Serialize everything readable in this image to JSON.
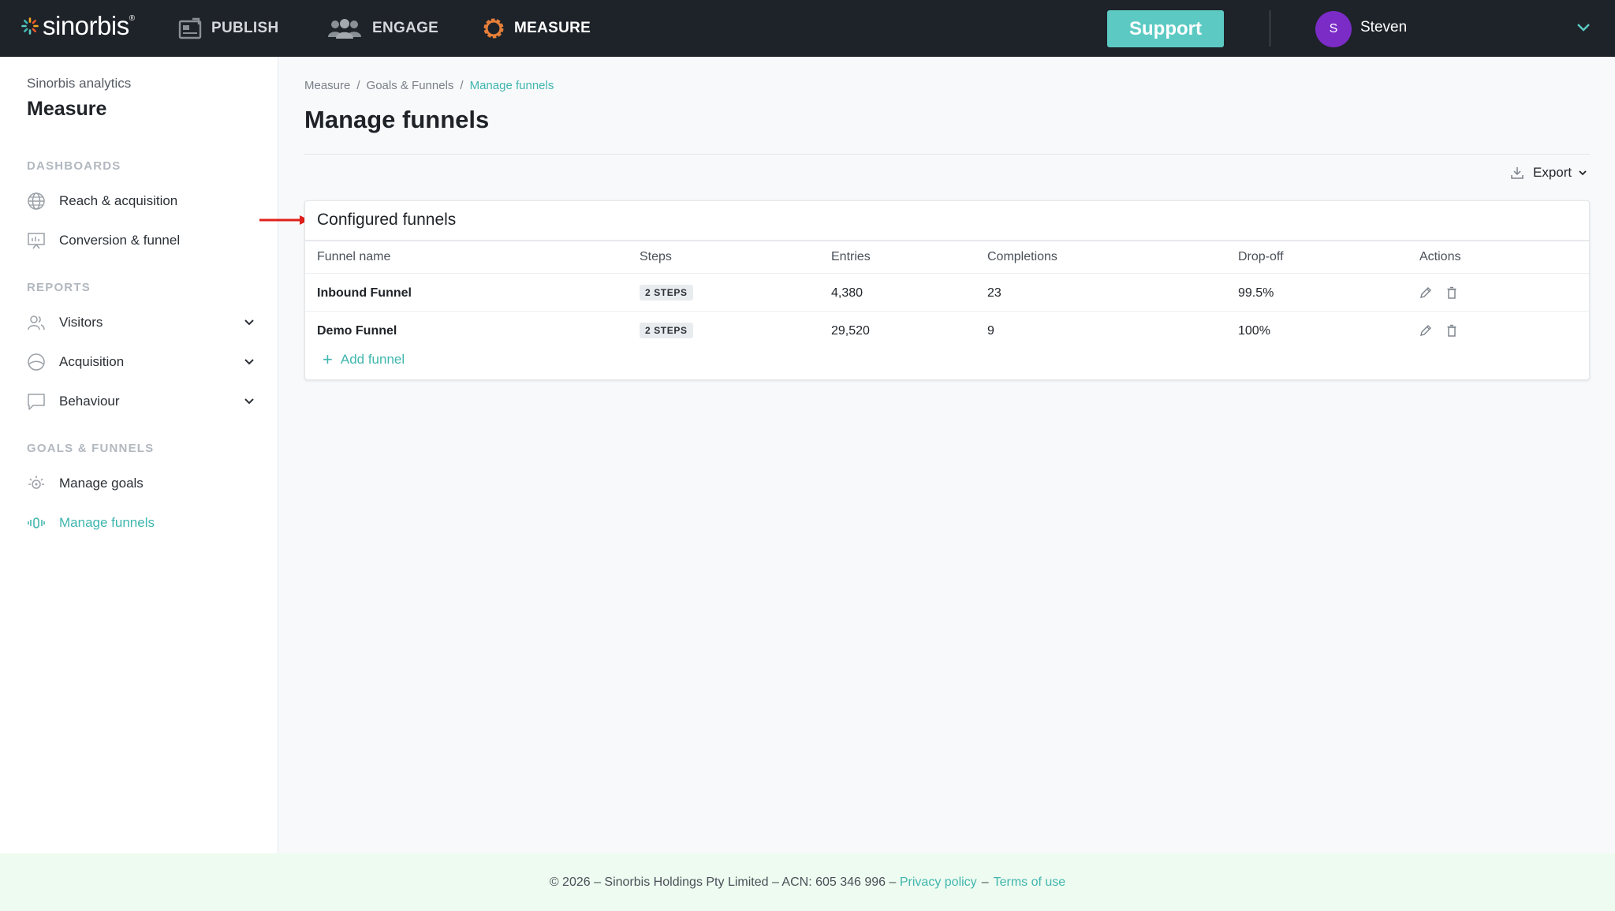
{
  "brand": {
    "name": "sinorbis",
    "accent": "#5ccac3",
    "nav_bg": "#1e2329"
  },
  "topnav": {
    "items": [
      {
        "label": "PUBLISH",
        "icon": "publish-icon"
      },
      {
        "label": "ENGAGE",
        "icon": "people-icon"
      },
      {
        "label": "MEASURE",
        "icon": "gear-icon",
        "active": true
      }
    ],
    "support_label": "Support",
    "user": {
      "initial": "S",
      "name": "Steven",
      "avatar_color": "#7b2cc6"
    }
  },
  "sidebar": {
    "app_name": "Sinorbis analytics",
    "title": "Measure",
    "sections": [
      {
        "label": "DASHBOARDS",
        "items": [
          {
            "label": "Reach & acquisition",
            "icon": "globe-icon"
          },
          {
            "label": "Conversion & funnel",
            "icon": "presentation-icon"
          }
        ]
      },
      {
        "label": "REPORTS",
        "items": [
          {
            "label": "Visitors",
            "icon": "visitors-icon",
            "expandable": true
          },
          {
            "label": "Acquisition",
            "icon": "acquisition-icon",
            "expandable": true
          },
          {
            "label": "Behaviour",
            "icon": "chat-icon",
            "expandable": true
          }
        ]
      },
      {
        "label": "GOALS & FUNNELS",
        "items": [
          {
            "label": "Manage goals",
            "icon": "goal-icon"
          },
          {
            "label": "Manage funnels",
            "icon": "funnel-icon",
            "active": true
          }
        ]
      }
    ]
  },
  "breadcrumb": [
    "Measure",
    "/",
    "Goals & Funnels",
    "/",
    "Manage funnels"
  ],
  "page_title": "Manage funnels",
  "export_label": "Export",
  "card": {
    "title": "Configured funnels",
    "columns": [
      "Funnel name",
      "Steps",
      "Entries",
      "Completions",
      "Drop-off",
      "Actions"
    ],
    "rows": [
      {
        "name": "Inbound Funnel",
        "steps": "2 STEPS",
        "entries": "4,380",
        "completions": "23",
        "dropoff": "99.5%"
      },
      {
        "name": "Demo Funnel",
        "steps": "2 STEPS",
        "entries": "29,520",
        "completions": "9",
        "dropoff": "100%"
      }
    ],
    "add_label": "Add funnel"
  },
  "footer": {
    "text": "© 2026 – Sinorbis Holdings Pty Limited – ACN: 605 346 996 –",
    "privacy": "Privacy policy",
    "dash": "–",
    "terms": "Terms of use"
  }
}
